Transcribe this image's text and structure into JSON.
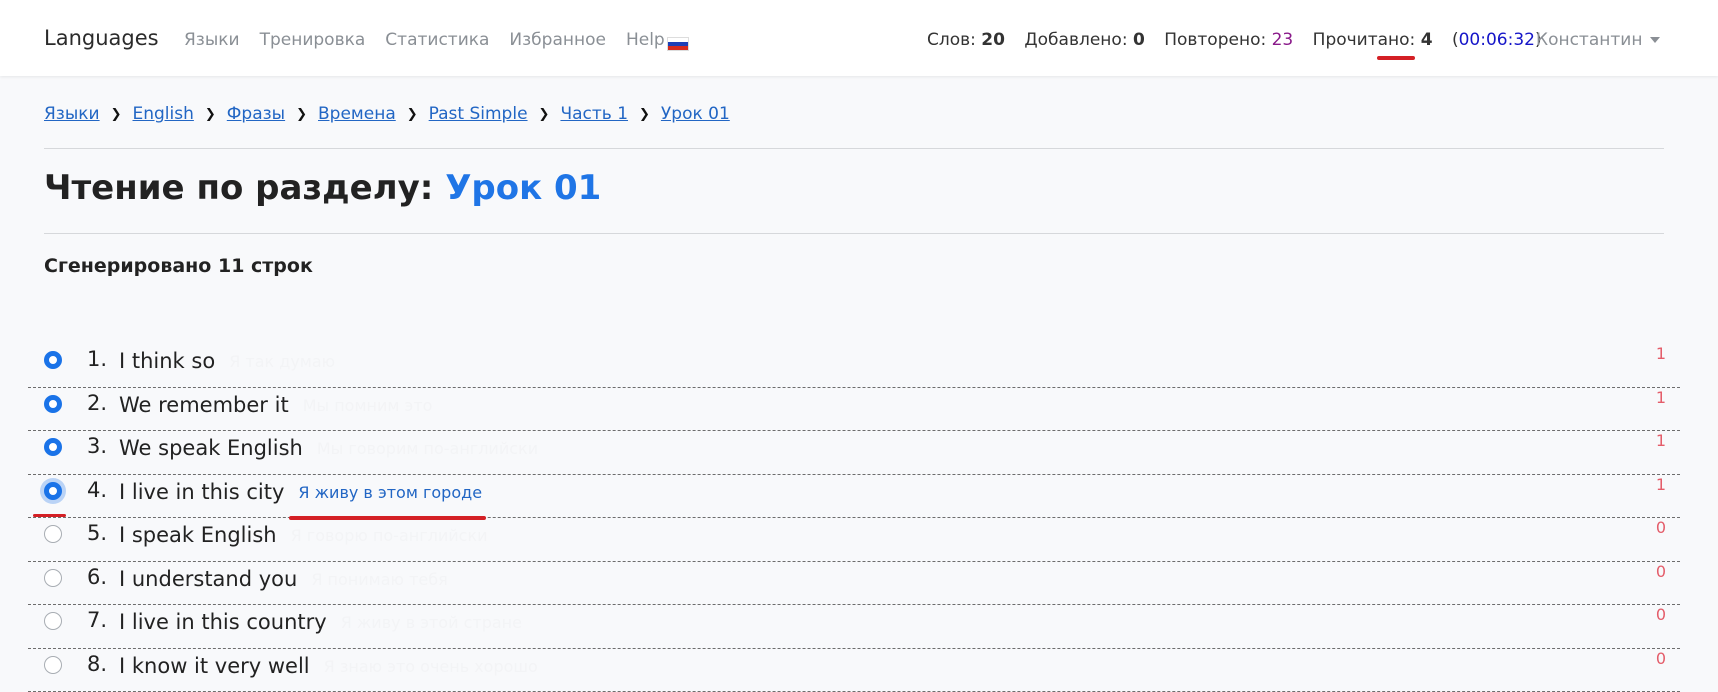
{
  "navbar": {
    "brand": "Languages",
    "links": [
      "Языки",
      "Тренировка",
      "Статистика",
      "Избранное",
      "Help"
    ],
    "flag_colors": [
      "#ffffff",
      "#1c3fb7",
      "#d52b1e"
    ],
    "stats": {
      "words_label": "Слов:",
      "words_value": "20",
      "added_label": "Добавлено:",
      "added_value": "0",
      "repeated_label": "Повторено:",
      "repeated_value": "23",
      "read_label": "Прочитано:",
      "read_value": "4",
      "time_open": "(",
      "time_value": "00:06:32",
      "time_close": ")"
    },
    "user": "Константин"
  },
  "breadcrumb": [
    "Языки",
    "English",
    "Фразы",
    "Времена",
    "Past Simple",
    "Часть 1",
    "Урок 01"
  ],
  "title": {
    "prefix": "Чтение по разделу:",
    "section": "Урок 01"
  },
  "subtitle": "Сгенерировано 11 строк",
  "rows": [
    {
      "num": "1.",
      "phrase": "I think so",
      "translation": "Я так думаю",
      "count": "1",
      "checked": true
    },
    {
      "num": "2.",
      "phrase": "We remember it",
      "translation": "Мы помним это",
      "count": "1",
      "checked": true
    },
    {
      "num": "3.",
      "phrase": "We speak English",
      "translation": "Мы говорим по-английски",
      "count": "1",
      "checked": true
    },
    {
      "num": "4.",
      "phrase": "I live in this city",
      "translation": "Я живу в этом городе",
      "count": "1",
      "checked": true
    },
    {
      "num": "5.",
      "phrase": "I speak English",
      "translation": "Я говорю по-английски",
      "count": "0",
      "checked": false
    },
    {
      "num": "6.",
      "phrase": "I understand you",
      "translation": "Я понимаю тебя",
      "count": "0",
      "checked": false
    },
    {
      "num": "7.",
      "phrase": "I live in this country",
      "translation": "Я живу в этой стране",
      "count": "0",
      "checked": false
    },
    {
      "num": "8.",
      "phrase": "I know it very well",
      "translation": "Я знаю это очень хорошо",
      "count": "0",
      "checked": false
    }
  ],
  "colors": {
    "accent": "#1f75e6",
    "link": "#2266c4",
    "count": "#e45d6a",
    "repeated": "#8a1a8a",
    "timer": "#1515c8",
    "highlight_underline": "#d42025"
  }
}
